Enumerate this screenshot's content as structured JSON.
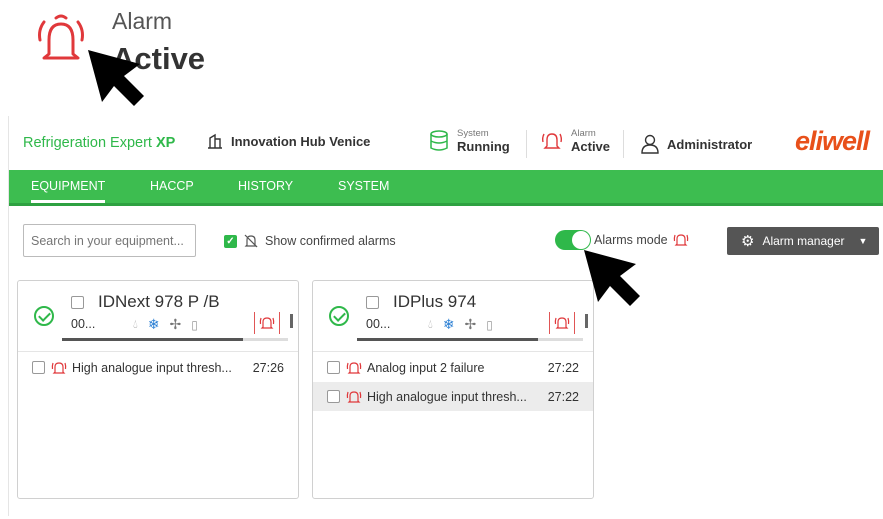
{
  "callout": {
    "label": "Alarm",
    "value": "Active"
  },
  "app": {
    "brand_main": "Refrigeration Expert",
    "brand_suffix": "XP",
    "site": "Innovation Hub Venice",
    "system": {
      "label": "System",
      "value": "Running"
    },
    "alarm": {
      "label": "Alarm",
      "value": "Active"
    },
    "user": "Administrator",
    "logo": "eliwell",
    "colors": {
      "accent": "#3dbd50",
      "alarm": "#e0383b",
      "logo": "#e8501a"
    }
  },
  "nav": {
    "tabs": [
      "EQUIPMENT",
      "HACCP",
      "HISTORY",
      "SYSTEM"
    ],
    "active": "EQUIPMENT"
  },
  "toolbar": {
    "search_placeholder": "Search in your equipment...",
    "show_confirmed": "Show confirmed alarms",
    "show_confirmed_checked": true,
    "alarms_mode": "Alarms mode",
    "alarms_mode_on": true,
    "alarm_manager": "Alarm manager"
  },
  "cards": [
    {
      "name": "IDNext 978 P /B",
      "value": "00...",
      "progress": 0.8,
      "alarms": [
        {
          "text": "High analogue input thresh...",
          "time": "27:26"
        }
      ]
    },
    {
      "name": "IDPlus 974",
      "value": "00...",
      "progress": 0.8,
      "alarms": [
        {
          "text": "Analog input 2 failure",
          "time": "27:22"
        },
        {
          "text": "High analogue input thresh...",
          "time": "27:22"
        }
      ]
    }
  ]
}
